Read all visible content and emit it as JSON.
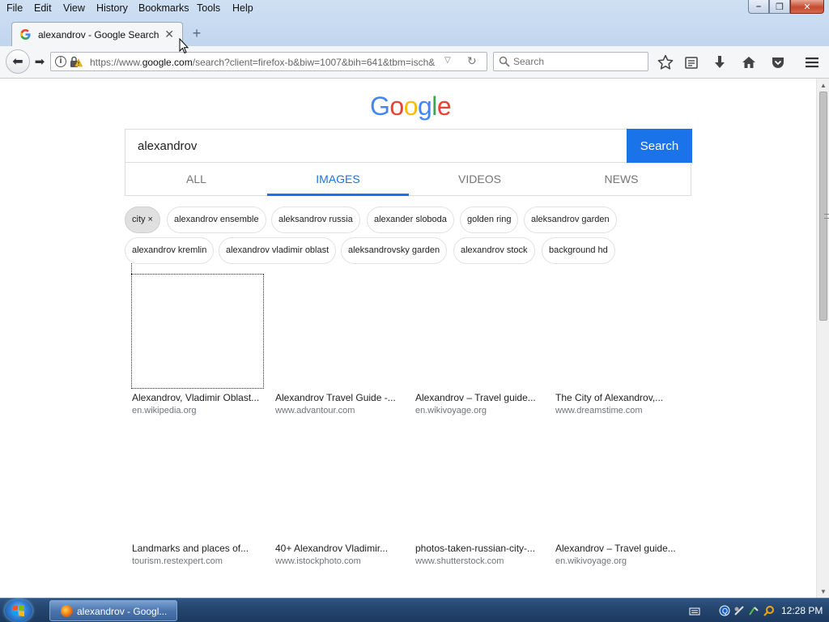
{
  "menubar": {
    "items": [
      "File",
      "Edit",
      "View",
      "History",
      "Bookmarks",
      "Tools",
      "Help"
    ]
  },
  "browser": {
    "tab_title": "alexandrov - Google Search",
    "url_prefix": "https://www.",
    "url_domain": "google.com",
    "url_rest": "/search?client=firefox-b&biw=1007&bih=641&tbm=isch&",
    "search_placeholder": "Search"
  },
  "google": {
    "query": "alexandrov",
    "search_button": "Search",
    "tabs": [
      "ALL",
      "IMAGES",
      "VIDEOS",
      "NEWS"
    ],
    "active_tab": "IMAGES",
    "chips_row1": [
      "city ×",
      "alexandrov ensemble",
      "aleksandrov russia",
      "alexander sloboda",
      "golden ring",
      "aleksandrov garden"
    ],
    "chips_row2": [
      "alexandrov kremlin",
      "alexandrov vladimir oblast",
      "aleksandrovsky garden",
      "alexandrov stock",
      "background hd"
    ],
    "results": [
      {
        "title": "Alexandrov, Vladimir Oblast...",
        "site": "en.wikipedia.org"
      },
      {
        "title": "Alexandrov Travel Guide -...",
        "site": "www.advantour.com"
      },
      {
        "title": "Alexandrov – Travel guide...",
        "site": "en.wikivoyage.org"
      },
      {
        "title": "The City of Alexandrov,...",
        "site": "www.dreamstime.com"
      },
      {
        "title": "Landmarks and places of...",
        "site": "tourism.restexpert.com"
      },
      {
        "title": "40+ Alexandrov Vladimir...",
        "site": "www.istockphoto.com"
      },
      {
        "title": "photos-taken-russian-city-...",
        "site": "www.shutterstock.com"
      },
      {
        "title": "Alexandrov – Travel guide...",
        "site": "en.wikivoyage.org"
      }
    ]
  },
  "taskbar": {
    "task_label": "alexandrov - Googl...",
    "clock": "12:28 PM"
  },
  "colors": {
    "google_blue": "#1a73e8",
    "logo_blue": "#4285f4",
    "logo_red": "#ea4335",
    "logo_yellow": "#fbbc05",
    "logo_green": "#34a853"
  },
  "icons": [
    "firefox-icon",
    "google-favicon",
    "back-arrow-icon",
    "forward-arrow-icon",
    "info-icon",
    "lock-warning-icon",
    "dropdown-icon",
    "reload-icon",
    "search-icon",
    "bookmark-star-icon",
    "reading-list-icon",
    "download-icon",
    "home-icon",
    "pocket-icon",
    "hamburger-menu-icon",
    "windows-start-icon"
  ]
}
